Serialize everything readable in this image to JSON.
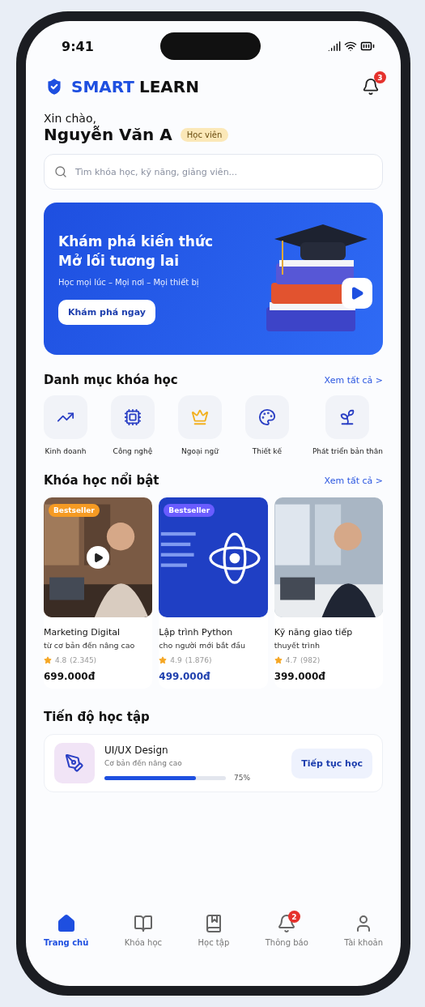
{
  "status_bar": {
    "time": "9:41"
  },
  "header": {
    "brand_primary": "SMART",
    "brand_secondary": "LEARN",
    "notification_count": "3"
  },
  "greeting": {
    "salutation": "Xin chào,",
    "name": "Nguyễn Văn A",
    "role_badge": "Học viên"
  },
  "search": {
    "placeholder": "Tìm khóa học, kỹ năng, giảng viên..."
  },
  "banner": {
    "title_lines": [
      "Khám phá kiến thức",
      "Mở lối tương lai"
    ],
    "subtitle": "Học mọi lúc – Mọi nơi – Mọi thiết bị",
    "button": "Khám phá ngay"
  },
  "categories": {
    "title": "Danh mục khóa học",
    "see_all": "Xem tất cả >",
    "items": [
      {
        "label": "Kinh doanh",
        "kind": "chart"
      },
      {
        "label": "Công nghệ",
        "kind": "tech"
      },
      {
        "label": "Ngoại ngữ",
        "kind": "crown"
      },
      {
        "label": "Thiết kế",
        "kind": "design"
      },
      {
        "label": "Phát triển bản thân",
        "kind": "growth"
      }
    ]
  },
  "featured": {
    "title": "Khóa học nổi bật",
    "see_all": "Xem tất cả >",
    "courses": [
      {
        "badge": "Bestseller",
        "color": "#f59a23",
        "play": true,
        "title": "Marketing Digital",
        "subtitle": "từ cơ bản đến nâng cao",
        "rating": "4.8",
        "reviews": "(2.345)",
        "price": "699.000đ",
        "price_highlighted": false
      },
      {
        "badge": "Bestseller",
        "color": "#6a5cff",
        "play": false,
        "title": "Lập trình Python",
        "subtitle": "cho người mới bắt đầu",
        "rating": "4.9",
        "reviews": "(1.876)",
        "price": "499.000đ",
        "price_highlighted": true
      },
      {
        "play": false,
        "title": "Kỹ năng giao tiếp",
        "subtitle": "thuyết trình",
        "rating": "4.7",
        "reviews": "(982)",
        "price": "399.000đ",
        "price_highlighted": false
      }
    ]
  },
  "progress": {
    "title": "Tiến độ học tập",
    "course": "UI/UX Design",
    "subtitle": "Cơ bản đến nâng cao",
    "level": 0.75,
    "percent": "75%",
    "button": "Tiếp tục học"
  },
  "tab_bar": [
    {
      "label": "Trang chủ",
      "kind": "home",
      "selected": true
    },
    {
      "label": "Khóa học",
      "kind": "book",
      "selected": false
    },
    {
      "label": "Học tập",
      "kind": "learn",
      "selected": false
    },
    {
      "label": "Thông báo",
      "kind": "bell",
      "selected": false,
      "badge": "2"
    },
    {
      "label": "Tài khoản",
      "kind": "user",
      "selected": false
    }
  ]
}
